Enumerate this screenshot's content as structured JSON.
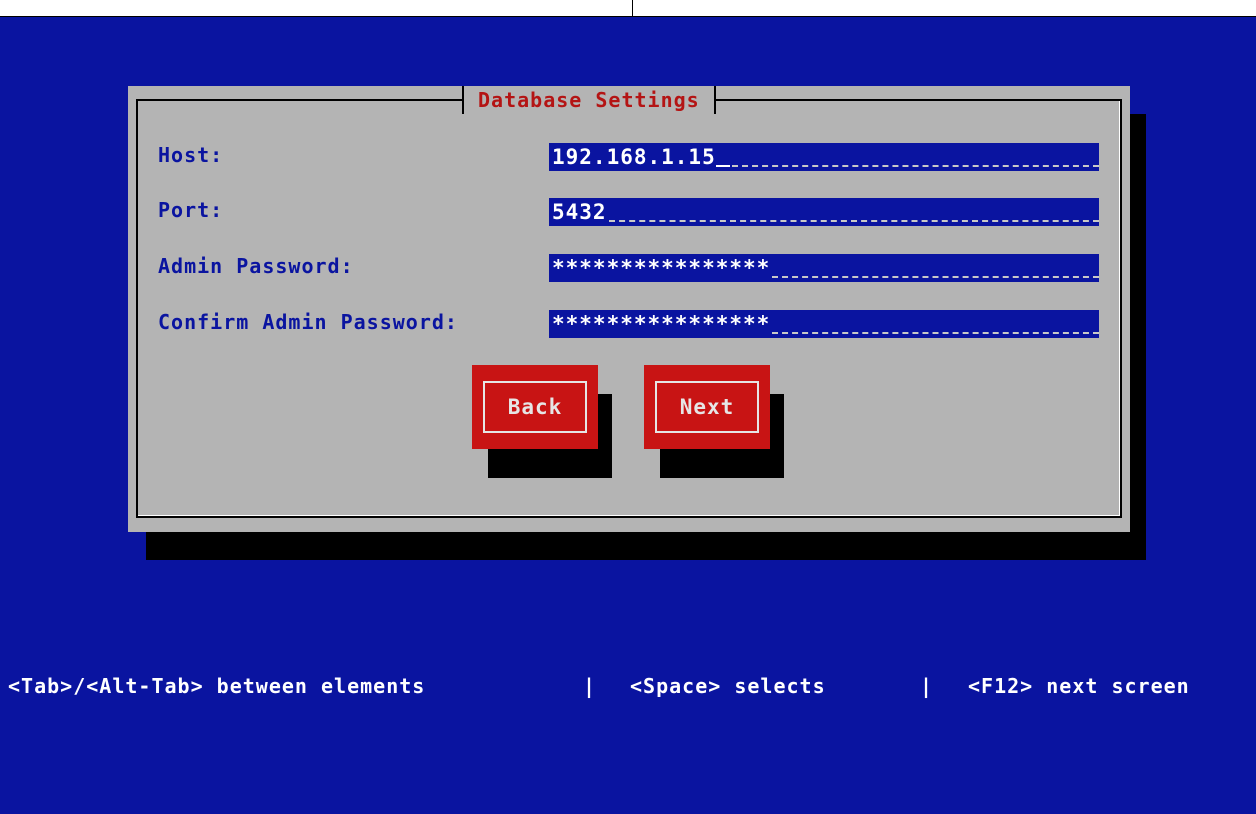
{
  "dialog": {
    "title": "Database Settings",
    "fields": [
      {
        "label": "Host:",
        "value": "192.168.1.15",
        "cursor": true
      },
      {
        "label": "Port:",
        "value": "5432",
        "cursor": false
      },
      {
        "label": "Admin Password:",
        "value": "****************",
        "cursor": false
      },
      {
        "label": "Confirm Admin Password:",
        "value": "****************",
        "cursor": false
      }
    ],
    "buttons": {
      "back": "Back",
      "next": "Next"
    }
  },
  "status": {
    "hint1": "<Tab>/<Alt-Tab> between elements",
    "sep": "|",
    "hint2": "<Space> selects",
    "hint3": "<F12> next screen"
  },
  "colors": {
    "background": "#0a14a0",
    "dialog": "#b4b4b4",
    "title": "#b41414",
    "button": "#c81414"
  }
}
